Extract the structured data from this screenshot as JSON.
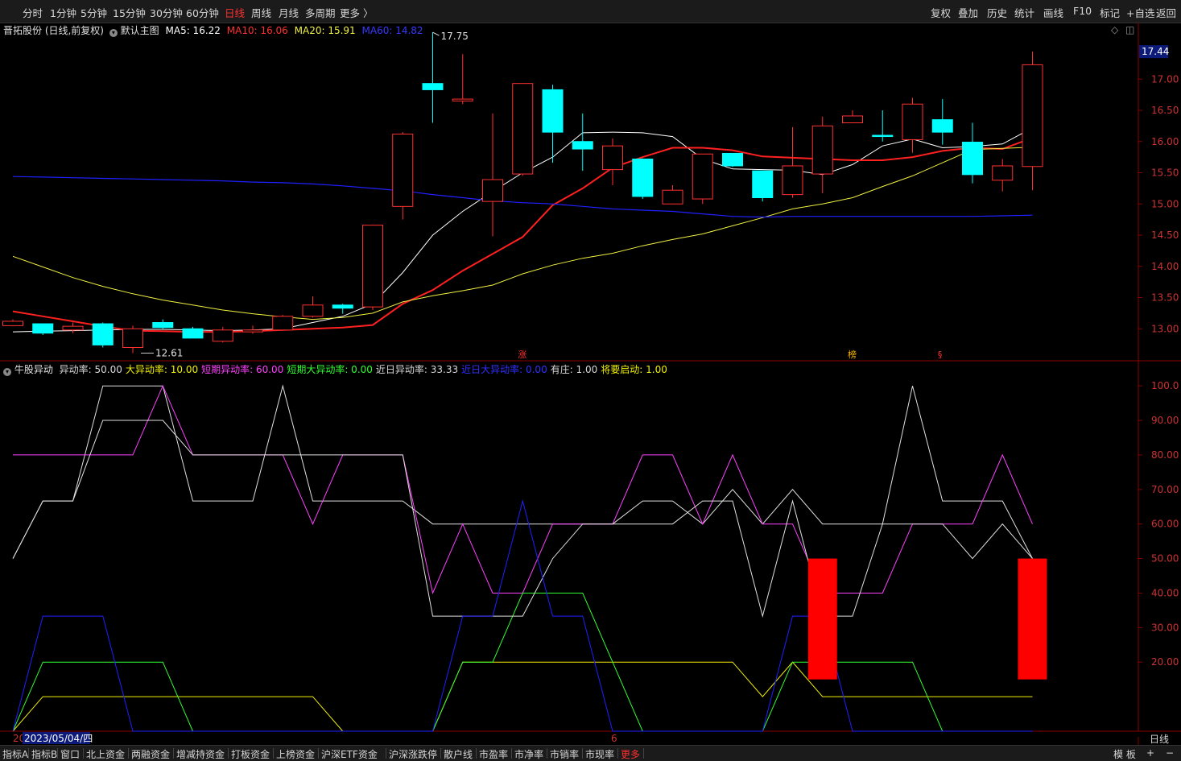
{
  "toolbar": {
    "periods": [
      "分时",
      "1分钟",
      "5分钟",
      "15分钟",
      "30分钟",
      "60分钟",
      "日线",
      "周线",
      "月线",
      "多周期",
      "更多 〉"
    ],
    "active_period": "日线",
    "actions": [
      "复权",
      "叠加",
      "历史",
      "统计",
      "画线",
      "F10",
      "标记",
      "+自选",
      "返回"
    ]
  },
  "main_info": {
    "stock": "晋拓股份 (日线,前复权)",
    "template": "默认主图",
    "ma5": "MA5: 16.22",
    "ma10": "MA10: 16.06",
    "ma20": "MA20: 15.91",
    "ma60": "MA60: 14.82"
  },
  "sub_info": {
    "title": "牛股异动",
    "items": [
      {
        "text": "异动率: 50.00",
        "color": "#d8d8d8"
      },
      {
        "text": "大异动率: 10.00",
        "color": "#f0f000"
      },
      {
        "text": "短期异动率: 60.00",
        "color": "#ff40ff"
      },
      {
        "text": "短期大异动率: 0.00",
        "color": "#30ff30"
      },
      {
        "text": "近日异动率: 33.33",
        "color": "#d8d8d8"
      },
      {
        "text": "近日大异动率: 0.00",
        "color": "#3030ff"
      },
      {
        "text": "有庄: 1.00",
        "color": "#d8d8d8"
      },
      {
        "text": "将要启动: 1.00",
        "color": "#f0f000"
      }
    ]
  },
  "colors": {
    "up": "#ff3030",
    "down": "#00ffff",
    "ma5": "#ffffff",
    "ma10": "#ff2020",
    "ma20": "#f0f040",
    "ma60": "#2020ff",
    "axis": "#8b0000",
    "label": "#cc3333"
  },
  "price_axis": {
    "labels": [
      "17.00",
      "16.50",
      "16.00",
      "15.50",
      "15.00",
      "14.50",
      "14.00",
      "13.50",
      "13.00"
    ],
    "current": "17.44"
  },
  "osc_axis": {
    "labels": [
      "100.0",
      "90.00",
      "80.00",
      "70.00",
      "60.00",
      "50.00",
      "40.00",
      "30.00",
      "20.00"
    ]
  },
  "annotations": {
    "high": "17.75",
    "low": "12.61",
    "markers": [
      "涨",
      "榜",
      "§"
    ]
  },
  "date_label": "2023/05/04/四",
  "date_marks": [
    "20",
    "6"
  ],
  "period_badge": "日线",
  "bottom_tabs": [
    "指标A",
    "指标B",
    "窗口",
    "北上资金",
    "两融资金",
    "增减持资金",
    "打板资金",
    "上榜资金",
    "沪深ETF资金",
    "沪深涨跌停",
    "散户线",
    "市盈率",
    "市净率",
    "市销率",
    "市现率",
    "更多"
  ],
  "bottom_right": [
    "模 板",
    "+",
    "−"
  ],
  "chart_data": [
    {
      "type": "candlestick",
      "ylim": [
        12.5,
        17.7
      ],
      "candles": [
        {
          "o": 13.05,
          "h": 13.15,
          "l": 13.05,
          "c": 13.12
        },
        {
          "o": 13.08,
          "h": 13.08,
          "l": 12.9,
          "c": 12.93
        },
        {
          "o": 12.98,
          "h": 13.1,
          "l": 12.93,
          "c": 13.04
        },
        {
          "o": 13.08,
          "h": 13.1,
          "l": 12.7,
          "c": 12.74
        },
        {
          "o": 12.7,
          "h": 13.05,
          "l": 12.61,
          "c": 13.0
        },
        {
          "o": 13.1,
          "h": 13.15,
          "l": 12.99,
          "c": 13.02
        },
        {
          "o": 13.0,
          "h": 13.03,
          "l": 12.85,
          "c": 12.85
        },
        {
          "o": 12.8,
          "h": 13.03,
          "l": 12.78,
          "c": 12.98
        },
        {
          "o": 12.95,
          "h": 13.05,
          "l": 12.92,
          "c": 12.98
        },
        {
          "o": 12.98,
          "h": 13.22,
          "l": 12.97,
          "c": 13.2
        },
        {
          "o": 13.2,
          "h": 13.52,
          "l": 13.18,
          "c": 13.38
        },
        {
          "o": 13.38,
          "h": 13.4,
          "l": 13.24,
          "c": 13.33
        },
        {
          "o": 13.35,
          "h": 14.66,
          "l": 13.3,
          "c": 14.66
        },
        {
          "o": 14.96,
          "h": 16.15,
          "l": 14.75,
          "c": 16.12
        },
        {
          "o": 16.93,
          "h": 17.75,
          "l": 16.3,
          "c": 16.83
        },
        {
          "o": 16.65,
          "h": 17.4,
          "l": 16.6,
          "c": 16.68
        },
        {
          "o": 15.04,
          "h": 16.45,
          "l": 14.48,
          "c": 15.39
        },
        {
          "o": 15.48,
          "h": 16.93,
          "l": 15.45,
          "c": 16.93
        },
        {
          "o": 16.83,
          "h": 16.91,
          "l": 15.66,
          "c": 16.15
        },
        {
          "o": 16.0,
          "h": 16.45,
          "l": 15.53,
          "c": 15.88
        },
        {
          "o": 15.55,
          "h": 16.05,
          "l": 15.3,
          "c": 15.93
        },
        {
          "o": 15.72,
          "h": 15.73,
          "l": 15.08,
          "c": 15.12
        },
        {
          "o": 15.0,
          "h": 15.3,
          "l": 15.0,
          "c": 15.22
        },
        {
          "o": 15.08,
          "h": 15.8,
          "l": 15.0,
          "c": 15.8
        },
        {
          "o": 15.81,
          "h": 15.81,
          "l": 15.59,
          "c": 15.61
        },
        {
          "o": 15.53,
          "h": 15.53,
          "l": 15.04,
          "c": 15.1
        },
        {
          "o": 15.15,
          "h": 16.23,
          "l": 15.1,
          "c": 15.61
        },
        {
          "o": 15.48,
          "h": 16.4,
          "l": 15.17,
          "c": 16.25
        },
        {
          "o": 16.3,
          "h": 16.5,
          "l": 16.3,
          "c": 16.41
        },
        {
          "o": 16.1,
          "h": 16.5,
          "l": 16.0,
          "c": 16.08
        },
        {
          "o": 16.03,
          "h": 16.7,
          "l": 15.82,
          "c": 16.6
        },
        {
          "o": 16.35,
          "h": 16.68,
          "l": 15.95,
          "c": 16.15
        },
        {
          "o": 15.99,
          "h": 16.3,
          "l": 15.33,
          "c": 15.47
        },
        {
          "o": 15.38,
          "h": 15.72,
          "l": 15.2,
          "c": 15.61
        },
        {
          "o": 15.6,
          "h": 17.44,
          "l": 15.22,
          "c": 17.23
        }
      ],
      "ma_series": [
        {
          "name": "MA5",
          "values": [
            12.95,
            12.96,
            12.97,
            12.98,
            12.99,
            12.99,
            12.98,
            12.97,
            12.98,
            13.0,
            13.1,
            13.2,
            13.4,
            13.9,
            14.5,
            14.88,
            15.2,
            15.5,
            15.75,
            16.14,
            16.15,
            16.14,
            16.08,
            15.72,
            15.56,
            15.55,
            15.54,
            15.47,
            15.63,
            15.93,
            16.04,
            15.9,
            15.92,
            15.96,
            16.22
          ]
        },
        {
          "name": "MA10",
          "values": [
            13.28,
            13.2,
            13.12,
            13.04,
            12.97,
            12.96,
            12.95,
            12.95,
            12.96,
            12.98,
            13.0,
            13.02,
            13.06,
            13.4,
            13.62,
            13.93,
            14.2,
            14.47,
            14.98,
            15.25,
            15.58,
            15.75,
            15.9,
            15.9,
            15.86,
            15.76,
            15.74,
            15.72,
            15.7,
            15.7,
            15.75,
            15.85,
            15.9,
            15.88,
            16.06
          ]
        },
        {
          "name": "MA20",
          "values": [
            14.16,
            13.99,
            13.82,
            13.68,
            13.56,
            13.46,
            13.38,
            13.3,
            13.24,
            13.19,
            13.15,
            13.18,
            13.25,
            13.43,
            13.53,
            13.61,
            13.7,
            13.88,
            14.02,
            14.13,
            14.21,
            14.33,
            14.43,
            14.52,
            14.65,
            14.78,
            14.92,
            15.0,
            15.1,
            15.28,
            15.45,
            15.66,
            15.87,
            15.89,
            15.91
          ]
        },
        {
          "name": "MA60",
          "values": [
            15.44,
            15.43,
            15.42,
            15.41,
            15.4,
            15.39,
            15.38,
            15.37,
            15.35,
            15.34,
            15.32,
            15.29,
            15.25,
            15.21,
            15.15,
            15.1,
            15.05,
            15.02,
            15.0,
            14.96,
            14.92,
            14.9,
            14.88,
            14.84,
            14.8,
            14.79,
            14.8,
            14.8,
            14.8,
            14.8,
            14.8,
            14.8,
            14.8,
            14.81,
            14.82
          ]
        }
      ]
    },
    {
      "type": "line",
      "ylim": [
        0,
        104
      ],
      "series": [
        {
          "name": "异动率",
          "values": [
            50,
            66.67,
            66.67,
            100,
            100,
            100,
            66.67,
            66.67,
            66.67,
            100,
            66.67,
            66.67,
            66.67,
            66.67,
            60,
            60,
            60,
            60,
            60,
            60,
            60,
            66.67,
            66.67,
            60,
            70,
            60,
            70,
            60,
            60,
            60,
            100,
            66.67,
            66.67,
            66.67,
            50
          ]
        },
        {
          "name": "大异动率",
          "values": [
            0,
            10,
            10,
            10,
            10,
            10,
            10,
            10,
            10,
            10,
            10,
            0,
            0,
            0,
            0,
            20,
            20,
            20,
            20,
            20,
            20,
            20,
            20,
            20,
            20,
            10,
            20,
            10,
            10,
            10,
            10,
            10,
            10,
            10,
            10
          ]
        },
        {
          "name": "短期异动率",
          "values": [
            80,
            80,
            80,
            80,
            80,
            100,
            80,
            80,
            80,
            80,
            60,
            80,
            80,
            80,
            40,
            60,
            40,
            40,
            60,
            60,
            60,
            80,
            80,
            60,
            80,
            60,
            60,
            40,
            40,
            40,
            60,
            60,
            60,
            80,
            60
          ]
        },
        {
          "name": "短期大异动率",
          "values": [
            0,
            20,
            20,
            20,
            20,
            20,
            0,
            0,
            0,
            0,
            0,
            0,
            0,
            0,
            0,
            20,
            20,
            40,
            40,
            40,
            20,
            0,
            0,
            0,
            0,
            0,
            20,
            20,
            20,
            20,
            20,
            0,
            0,
            0,
            0
          ]
        },
        {
          "name": "近日异动率",
          "values": [
            50,
            66.67,
            66.67,
            90,
            90,
            90,
            80,
            80,
            80,
            80,
            80,
            80,
            80,
            80,
            33.33,
            33.33,
            33.33,
            33.33,
            50,
            60,
            60,
            60,
            60,
            66.67,
            66.67,
            33.33,
            66.67,
            33.33,
            33.33,
            60,
            60,
            60,
            50,
            60,
            50
          ]
        },
        {
          "name": "近日大异动率",
          "values": [
            0,
            33.33,
            33.33,
            33.33,
            0,
            0,
            0,
            0,
            0,
            0,
            0,
            0,
            0,
            0,
            0,
            33.33,
            33.33,
            66.67,
            33.33,
            33.33,
            0,
            0,
            0,
            0,
            0,
            0,
            33.33,
            33.33,
            0,
            0,
            0,
            0,
            0,
            0,
            0
          ]
        }
      ],
      "bars": [
        {
          "index": 27,
          "top": 50,
          "bottom": 15
        },
        {
          "index": 34,
          "top": 50,
          "bottom": 15
        }
      ]
    }
  ]
}
